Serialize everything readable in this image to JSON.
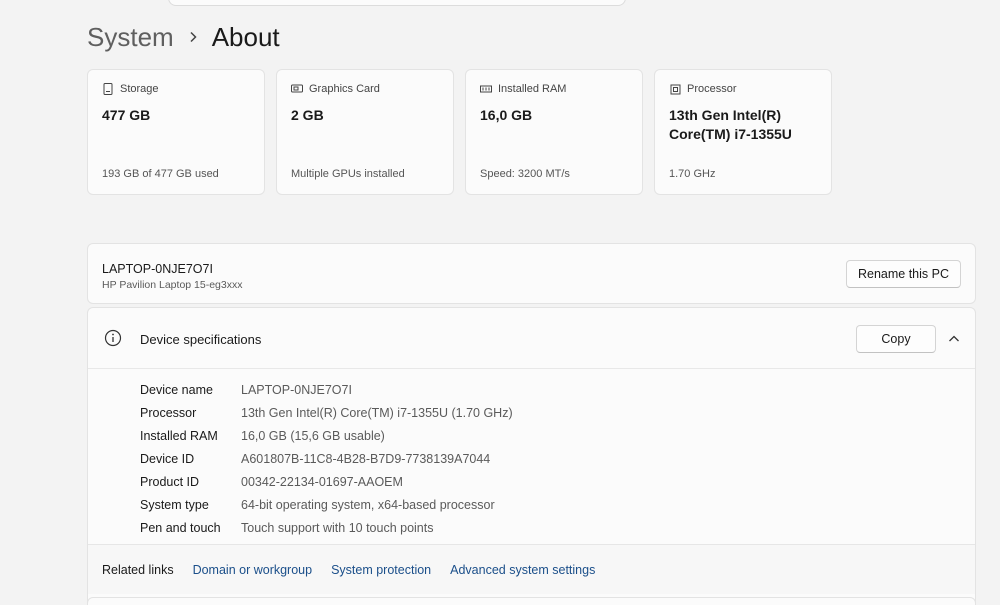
{
  "breadcrumb": {
    "parent": "System",
    "current": "About"
  },
  "cards": [
    {
      "label": "Storage",
      "value": "477 GB",
      "sub": "193 GB of 477 GB used",
      "icon": "storage-icon"
    },
    {
      "label": "Graphics Card",
      "value": "2 GB",
      "sub": "Multiple GPUs installed",
      "icon": "graphics-card-icon"
    },
    {
      "label": "Installed RAM",
      "value": "16,0 GB",
      "sub": "Speed: 3200 MT/s",
      "icon": "ram-icon"
    },
    {
      "label": "Processor",
      "value": "13th Gen Intel(R) Core(TM) i7-1355U",
      "sub": "1.70 GHz",
      "icon": "processor-icon"
    }
  ],
  "pc": {
    "name": "LAPTOP-0NJE7O7I",
    "model": "HP Pavilion Laptop 15-eg3xxx",
    "rename_label": "Rename this PC"
  },
  "specs": {
    "title": "Device specifications",
    "copy_label": "Copy",
    "rows": [
      {
        "label": "Device name",
        "value": "LAPTOP-0NJE7O7I"
      },
      {
        "label": "Processor",
        "value": "13th Gen Intel(R) Core(TM) i7-1355U (1.70 GHz)"
      },
      {
        "label": "Installed RAM",
        "value": "16,0 GB (15,6 GB usable)"
      },
      {
        "label": "Device ID",
        "value": "A601807B-11C8-4B28-B7D9-7738139A7044"
      },
      {
        "label": "Product ID",
        "value": "00342-22134-01697-AAOEM"
      },
      {
        "label": "System type",
        "value": "64-bit operating system, x64-based processor"
      },
      {
        "label": "Pen and touch",
        "value": "Touch support with 10 touch points"
      }
    ]
  },
  "related": {
    "label": "Related links",
    "links": [
      "Domain or workgroup",
      "System protection",
      "Advanced system settings"
    ]
  },
  "colors": {
    "link": "#1b4f8a",
    "background": "#f3f3f3",
    "card": "#fbfbfb"
  }
}
